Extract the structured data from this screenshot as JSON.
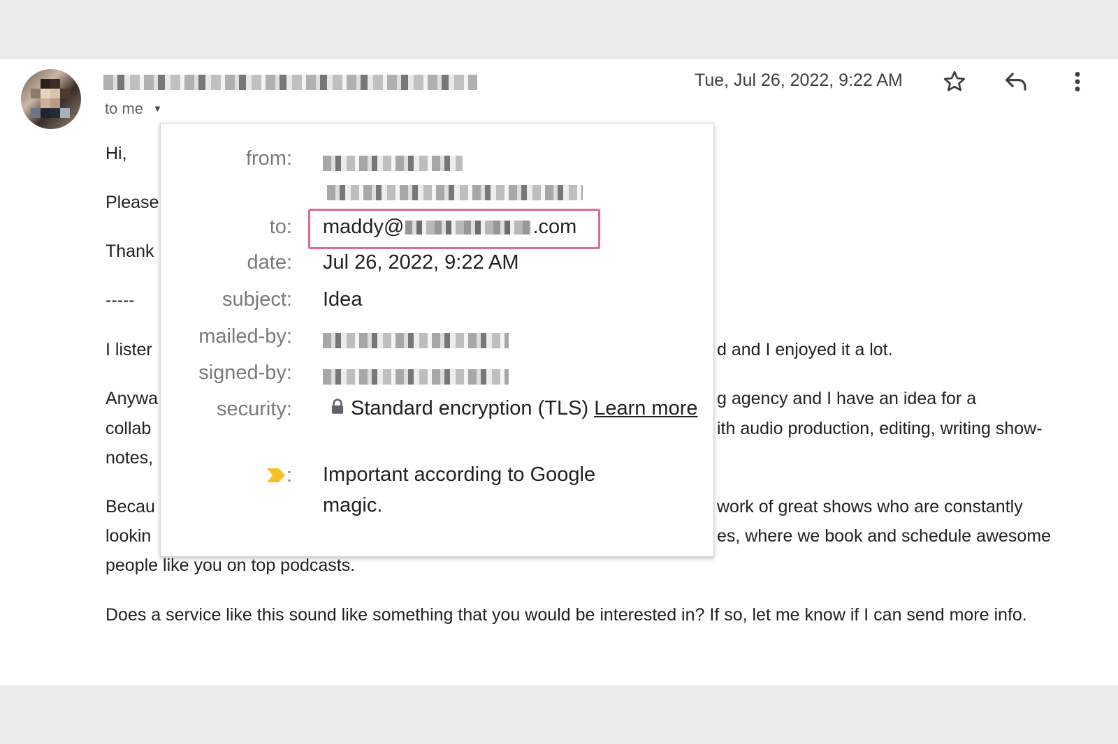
{
  "header": {
    "to_label": "to me",
    "date": "Tue, Jul 26, 2022, 9:22 AM",
    "icons": {
      "star": "star-icon",
      "reply": "reply-icon",
      "more": "more-vert-icon",
      "caret": "caret-down-icon"
    }
  },
  "body": {
    "greeting": "Hi,",
    "line_please": "Please",
    "line_thanks": "Thank",
    "separator": "-----",
    "p1_left": "I lister",
    "p1_right": "d and I enjoyed it a lot.",
    "p2_left": "Anywa",
    "p2_left2": "collab",
    "p2_left3": "notes,",
    "p2_right1": "g agency and I have an idea for a",
    "p2_right2": "ith audio production, editing, writing show-",
    "p3_left1": "Becau",
    "p3_left2": "lookin",
    "p3_right1": "work of great shows who are constantly",
    "p3_right2": "es, where we book and schedule awesome",
    "p3_tail": "people like you on top podcasts.",
    "p4": "Does a service like this sound like something that you would be interested in? If so, let me know if I can send more info."
  },
  "details_popup": {
    "from_label": "from:",
    "to_label": "to:",
    "to_prefix": "maddy@",
    "to_suffix": ".com",
    "date_label": "date:",
    "date_value": "Jul 26, 2022, 9:22 AM",
    "subject_label": "subject:",
    "subject_value": "Idea",
    "mailed_by_label": "mailed-by:",
    "signed_by_label": "signed-by:",
    "security_label": "security:",
    "security_value": "Standard encryption (TLS)",
    "learn_more": "Learn more",
    "importance_colon": ":",
    "importance_value": "Important according to Google magic.",
    "colors": {
      "highlight_border": "#e0689a",
      "importance_marker": "#f6c026"
    }
  }
}
